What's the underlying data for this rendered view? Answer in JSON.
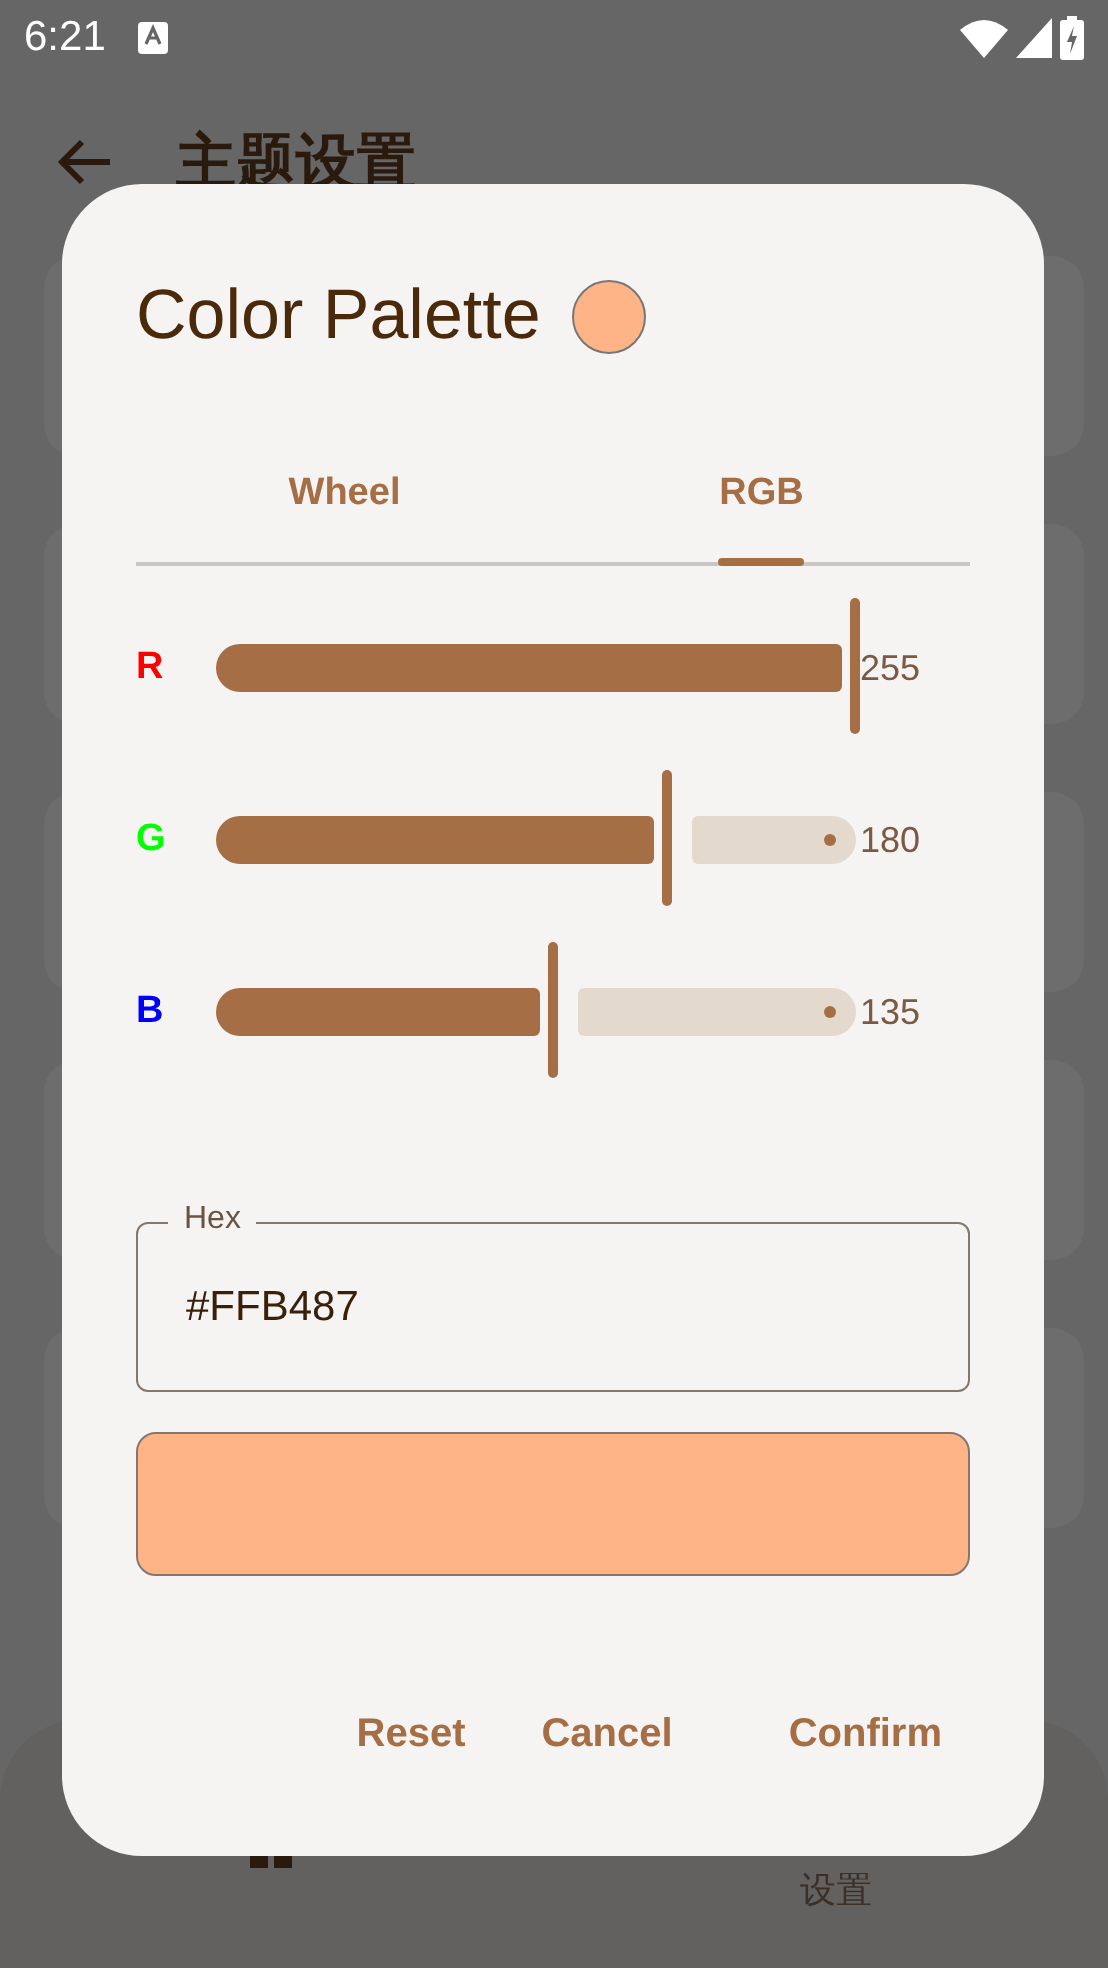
{
  "status_bar": {
    "time": "6:21"
  },
  "app_bar": {
    "title": "主题设置"
  },
  "bottom_nav": {
    "items": [
      {
        "label": "设置"
      }
    ]
  },
  "dialog": {
    "title": "Color Palette",
    "tabs": [
      {
        "label": "Wheel",
        "selected": false
      },
      {
        "label": "RGB",
        "selected": true
      }
    ],
    "channels": [
      {
        "name": "R",
        "color": "#ff0000",
        "level": 1.0,
        "reading": "255"
      },
      {
        "name": "G",
        "color": "#00ff00",
        "level": 0.706,
        "reading": "180"
      },
      {
        "name": "B",
        "color": "#0000ff",
        "level": 0.529,
        "reading": "135"
      }
    ],
    "hex_field": {
      "label": "Hex",
      "value": "#FFB487"
    },
    "buttons": [
      "Reset",
      "Cancel",
      "Confirm"
    ]
  }
}
